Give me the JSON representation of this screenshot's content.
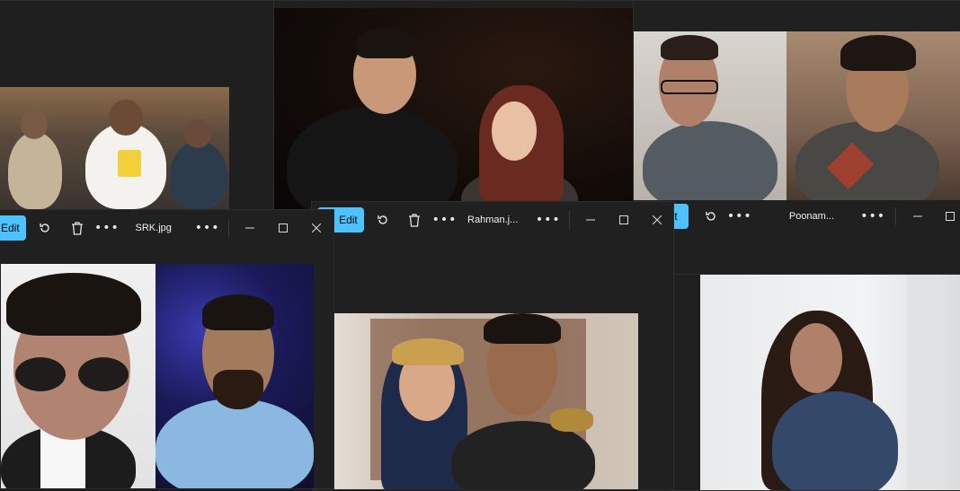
{
  "windows": {
    "left": {
      "edit_label": "Edit",
      "filename": "SRK.jpg"
    },
    "middle": {
      "edit_label": "Edit",
      "filename": "Rahman.j..."
    },
    "right": {
      "edit_label": "Edit",
      "filename": "Poonam..."
    }
  },
  "icons": {
    "edit": "pencil-icon",
    "rotate": "rotate-icon",
    "delete": "trash-icon",
    "more": "more-options-icon",
    "minimize": "minimize-icon",
    "maximize": "maximize-icon",
    "close": "close-icon"
  },
  "colors": {
    "accent": "#4cc2ff",
    "window_bg": "#202020",
    "desktop_bg": "#1a1a1a"
  }
}
